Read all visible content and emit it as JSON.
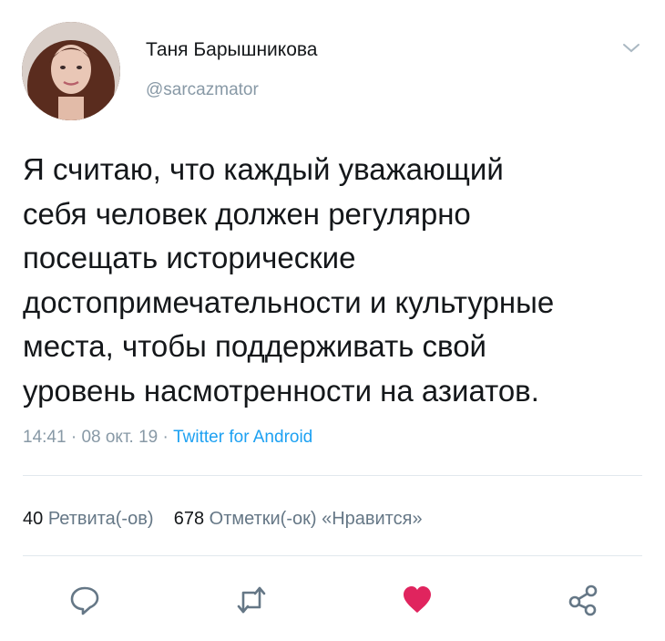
{
  "tweet": {
    "author_name": "Таня Барышникова",
    "author_handle": "@sarcazmator",
    "text_lines": [
      "Я считаю, что каждый уважающий",
      "себя человек должен регулярно",
      "посещать исторические",
      "достопримечательности и культурные",
      "места, чтобы поддерживать свой",
      "уровень насмотренности на азиатов."
    ],
    "time": "14:41",
    "date": "08 окт. 19",
    "source": "Twitter for Android",
    "separator": " · "
  },
  "stats": {
    "retweets_count": "40",
    "retweets_label": "Ретвита(-ов)",
    "likes_count": "678",
    "likes_label": "Отметки(-ок) «Нравится»"
  },
  "actions": {
    "reply_icon": "reply-icon",
    "retweet_icon": "retweet-icon",
    "like_icon": "heart-icon",
    "share_icon": "share-icon"
  },
  "colors": {
    "like_active": "#e0245e",
    "link": "#1da1f2",
    "muted": "#8899a6"
  }
}
